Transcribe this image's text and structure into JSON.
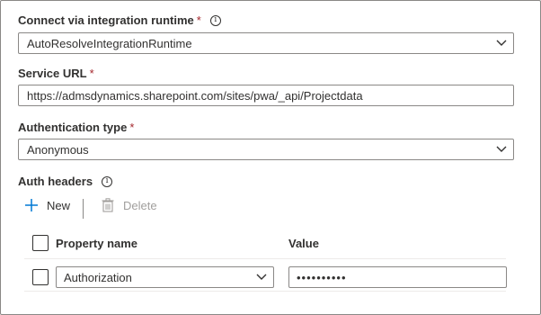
{
  "integration_runtime": {
    "label": "Connect via integration runtime",
    "required_mark": "*",
    "info_icon": "info-icon",
    "selected_value": "AutoResolveIntegrationRuntime"
  },
  "service_url": {
    "label": "Service URL",
    "required_mark": "*",
    "value": "https://admsdynamics.sharepoint.com/sites/pwa/_api/Projectdata"
  },
  "authentication_type": {
    "label": "Authentication type",
    "required_mark": "*",
    "selected_value": "Anonymous"
  },
  "auth_headers": {
    "label": "Auth headers",
    "info_icon": "info-icon",
    "toolbar": {
      "new_label": "New",
      "delete_label": "Delete"
    },
    "columns": {
      "property_name": "Property name",
      "value": "Value"
    },
    "rows": [
      {
        "property": "Authorization",
        "value_masked": "••••••••••"
      }
    ]
  },
  "colors": {
    "accent": "#0078d4",
    "required": "#a4262c",
    "disabled": "#a19f9d"
  }
}
